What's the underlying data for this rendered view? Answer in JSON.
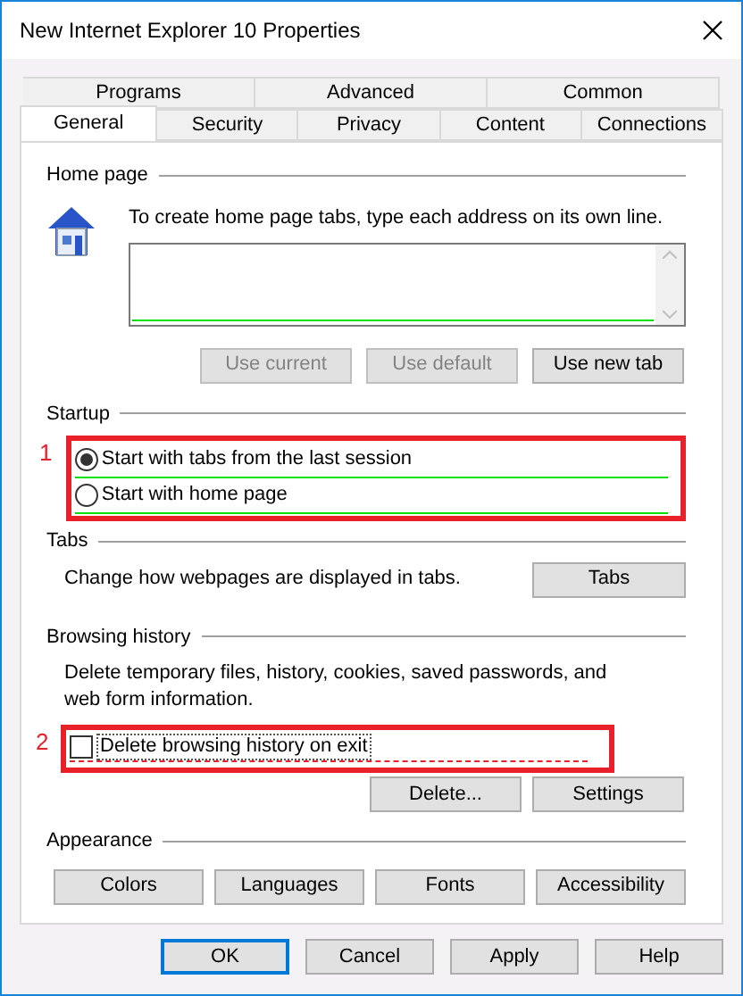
{
  "window": {
    "title": "New Internet Explorer 10 Properties"
  },
  "tab_rows": [
    [
      {
        "label": "Programs",
        "selected": false
      },
      {
        "label": "Advanced",
        "selected": false
      },
      {
        "label": "Common",
        "selected": false
      }
    ],
    [
      {
        "label": "General",
        "selected": true
      },
      {
        "label": "Security",
        "selected": false
      },
      {
        "label": "Privacy",
        "selected": false
      },
      {
        "label": "Content",
        "selected": false
      },
      {
        "label": "Connections",
        "selected": false
      }
    ]
  ],
  "home_page": {
    "label": "Home page",
    "instruction": "To create home page tabs, type each address on its own line.",
    "buttons": [
      {
        "label": "Use current",
        "disabled": true
      },
      {
        "label": "Use default",
        "disabled": true
      },
      {
        "label": "Use new tab",
        "disabled": false
      }
    ]
  },
  "startup": {
    "label": "Startup",
    "annotation": "1",
    "options": [
      {
        "label": "Start with tabs from the last session",
        "selected": true
      },
      {
        "label": "Start with home page",
        "selected": false
      }
    ]
  },
  "tabs_section": {
    "label": "Tabs",
    "description": "Change how webpages are displayed in tabs.",
    "button": "Tabs"
  },
  "browsing_history": {
    "label": "Browsing history",
    "description": "Delete temporary files, history, cookies, saved passwords, and web form information.",
    "annotation": "2",
    "delete_on_exit": {
      "label": "Delete browsing history on exit",
      "checked": false
    },
    "buttons": [
      "Delete...",
      "Settings"
    ]
  },
  "appearance": {
    "label": "Appearance",
    "buttons": [
      "Colors",
      "Languages",
      "Fonts",
      "Accessibility"
    ]
  },
  "footer_buttons": [
    {
      "label": "OK",
      "default": true
    },
    {
      "label": "Cancel",
      "default": false
    },
    {
      "label": "Apply",
      "default": false
    },
    {
      "label": "Help",
      "default": false
    }
  ]
}
